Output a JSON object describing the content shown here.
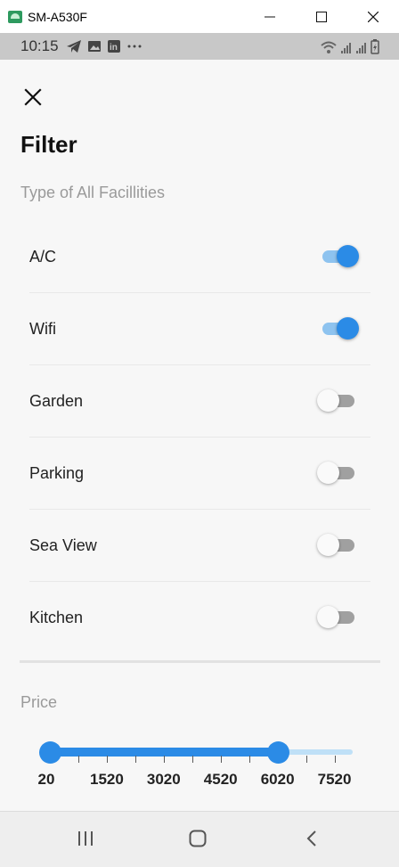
{
  "window": {
    "title": "SM-A530F"
  },
  "statusbar": {
    "time": "10:15"
  },
  "filter": {
    "title": "Filter",
    "facilities_label": "Type of All Facillities",
    "items": [
      {
        "label": "A/C",
        "on": true
      },
      {
        "label": "Wifi",
        "on": true
      },
      {
        "label": "Garden",
        "on": false
      },
      {
        "label": "Parking",
        "on": false
      },
      {
        "label": "Sea View",
        "on": false
      },
      {
        "label": "Kitchen",
        "on": false
      }
    ],
    "price_label": "Price",
    "price": {
      "min": 20,
      "max": 8000,
      "range_start": 20,
      "range_end": 6020,
      "tick_labels": [
        "20",
        "1520",
        "3020",
        "4520",
        "6020",
        "7520"
      ]
    }
  },
  "colors": {
    "accent": "#2b8be6",
    "accent_light": "#8ec3ef",
    "track_off": "#a0a0a0"
  },
  "icons": {
    "close": "close-icon",
    "nav_recent": "recent-apps-icon",
    "nav_home": "home-icon",
    "nav_back": "back-icon"
  }
}
